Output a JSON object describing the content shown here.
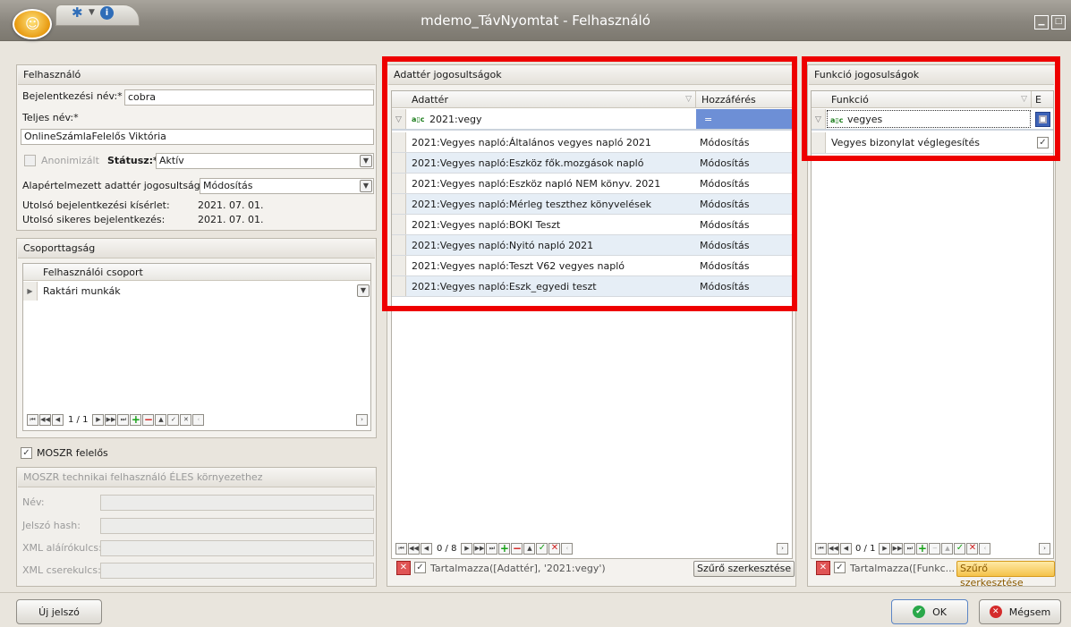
{
  "window": {
    "title": "mdemo_TávNyomtat - Felhasználó"
  },
  "user_panel": {
    "header": "Felhasználó",
    "login_label": "Bejelentkezési név:*",
    "login_value": "cobra",
    "fullname_label": "Teljes név:*",
    "fullname_value": "OnlineSzámlaFelelős Viktória",
    "anon_label": "Anonimizált",
    "status_label": "Státusz:*",
    "status_value": "Aktív",
    "default_perm_label": "Alapértelmezett adattér jogosultság:",
    "default_perm_value": "Módosítás",
    "last_attempt_label": "Utolsó bejelentkezési kísérlet:",
    "last_attempt_value": "2021. 07. 01.",
    "last_success_label": "Utolsó sikeres bejelentkezés:",
    "last_success_value": "2021. 07. 01."
  },
  "group_panel": {
    "header": "Csoporttagság",
    "column": "Felhasználói csoport",
    "rows": [
      "Raktári munkák"
    ],
    "nav": "1 / 1"
  },
  "moszr": {
    "checkbox_label": "MOSZR felelős",
    "checked": true,
    "header": "MOSZR technikai felhasználó ÉLES környezethez",
    "name_label": "Név:",
    "hash_label": "Jelszó hash:",
    "sign_label": "XML aláírókulcs:",
    "exchange_label": "XML cserekulcs:"
  },
  "data_panel": {
    "header": "Adattér jogosultságok",
    "col_adatter": "Adattér",
    "col_hozzaferes": "Hozzáférés",
    "filter_text": "2021:vegy",
    "filter_op": "=",
    "rows": [
      {
        "name": "2021:Vegyes napló:Általános vegyes napló 2021",
        "access": "Módosítás"
      },
      {
        "name": "2021:Vegyes napló:Eszköz fők.mozgások napló",
        "access": "Módosítás"
      },
      {
        "name": "2021:Vegyes napló:Eszköz napló NEM könyv. 2021",
        "access": "Módosítás"
      },
      {
        "name": "2021:Vegyes napló:Mérleg teszthez könyvelések",
        "access": "Módosítás"
      },
      {
        "name": "2021:Vegyes napló:BOKI Teszt",
        "access": "Módosítás"
      },
      {
        "name": "2021:Vegyes napló:Nyitó napló 2021",
        "access": "Módosítás"
      },
      {
        "name": "2021:Vegyes napló:Teszt V62 vegyes napló",
        "access": "Módosítás"
      },
      {
        "name": "2021:Vegyes napló:Eszk_egyedi teszt",
        "access": "Módosítás"
      }
    ],
    "nav": "0 / 8",
    "filter_expr": "Tartalmazza([Adattér], '2021:vegy')",
    "edit_filter": "Szűrő szerkesztése"
  },
  "func_panel": {
    "header": "Funkció jogosulságok",
    "col_funkcio": "Funkció",
    "col_e": "E",
    "filter_text": "vegyes",
    "rows": [
      {
        "name": "Vegyes bizonylat véglegesítés",
        "checked": true
      }
    ],
    "nav": "0 / 1",
    "filter_expr": "Tartalmazza([Funkc...",
    "edit_filter": "Szűrő szerkesztése"
  },
  "footer": {
    "new_password": "Új jelszó",
    "ok": "OK",
    "cancel": "Mégsem"
  },
  "highlight_color": "#ee0000"
}
